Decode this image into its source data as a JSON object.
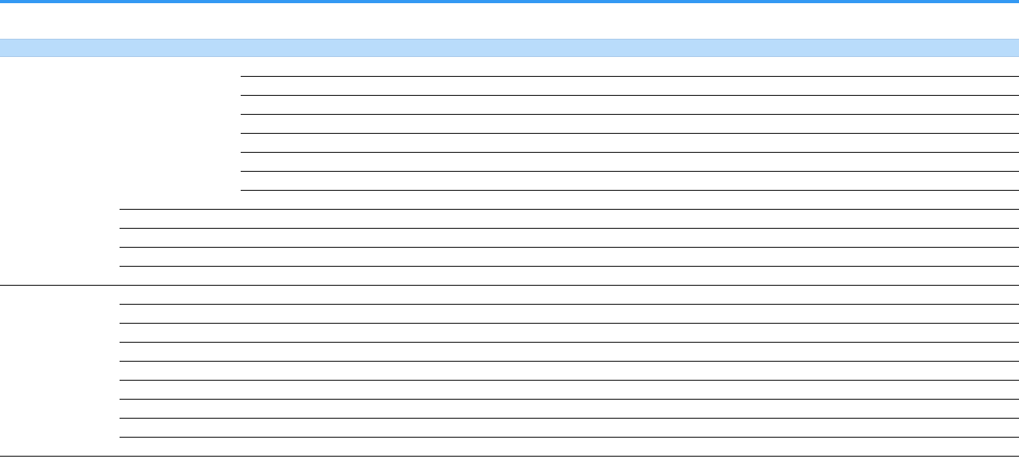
{
  "theme": {
    "accent_color": "#3399f3",
    "header_band_color": "#b9dcfb",
    "rule_color": "#000000"
  },
  "table": {
    "title": "",
    "columns": [
      "",
      "",
      "",
      ""
    ],
    "groups": [
      {
        "label": "",
        "subgroups": [
          {
            "label": "",
            "rows": [
              {
                "cells": [
                  "",
                  ""
                ]
              },
              {
                "cells": [
                  "",
                  ""
                ]
              },
              {
                "cells": [
                  "",
                  ""
                ]
              },
              {
                "cells": [
                  "",
                  ""
                ]
              },
              {
                "cells": [
                  "",
                  ""
                ]
              },
              {
                "cells": [
                  "",
                  ""
                ]
              },
              {
                "cells": [
                  "",
                  ""
                ]
              },
              {
                "cells": [
                  "",
                  ""
                ]
              }
            ]
          },
          {
            "label": "",
            "rows": [
              {
                "cells": [
                  "",
                  ""
                ]
              }
            ]
          },
          {
            "label": "",
            "rows": [
              {
                "cells": [
                  "",
                  ""
                ]
              }
            ]
          },
          {
            "label": "",
            "rows": [
              {
                "cells": [
                  "",
                  ""
                ]
              }
            ]
          },
          {
            "label": "",
            "rows": [
              {
                "cells": [
                  "",
                  ""
                ]
              }
            ]
          }
        ]
      },
      {
        "label": "",
        "subgroups": [
          {
            "label": "",
            "rows": [
              {
                "cells": [
                  "",
                  ""
                ]
              }
            ]
          },
          {
            "label": "",
            "rows": [
              {
                "cells": [
                  "",
                  ""
                ]
              }
            ]
          },
          {
            "label": "",
            "rows": [
              {
                "cells": [
                  "",
                  ""
                ]
              }
            ]
          },
          {
            "label": "",
            "rows": [
              {
                "cells": [
                  "",
                  ""
                ]
              }
            ]
          },
          {
            "label": "",
            "rows": [
              {
                "cells": [
                  "",
                  ""
                ]
              }
            ]
          },
          {
            "label": "",
            "rows": [
              {
                "cells": [
                  "",
                  ""
                ]
              }
            ]
          },
          {
            "label": "",
            "rows": [
              {
                "cells": [
                  "",
                  ""
                ]
              }
            ]
          },
          {
            "label": "",
            "rows": [
              {
                "cells": [
                  "",
                  ""
                ]
              }
            ]
          },
          {
            "label": "",
            "rows": [
              {
                "cells": [
                  "",
                  ""
                ]
              }
            ]
          }
        ]
      }
    ]
  }
}
